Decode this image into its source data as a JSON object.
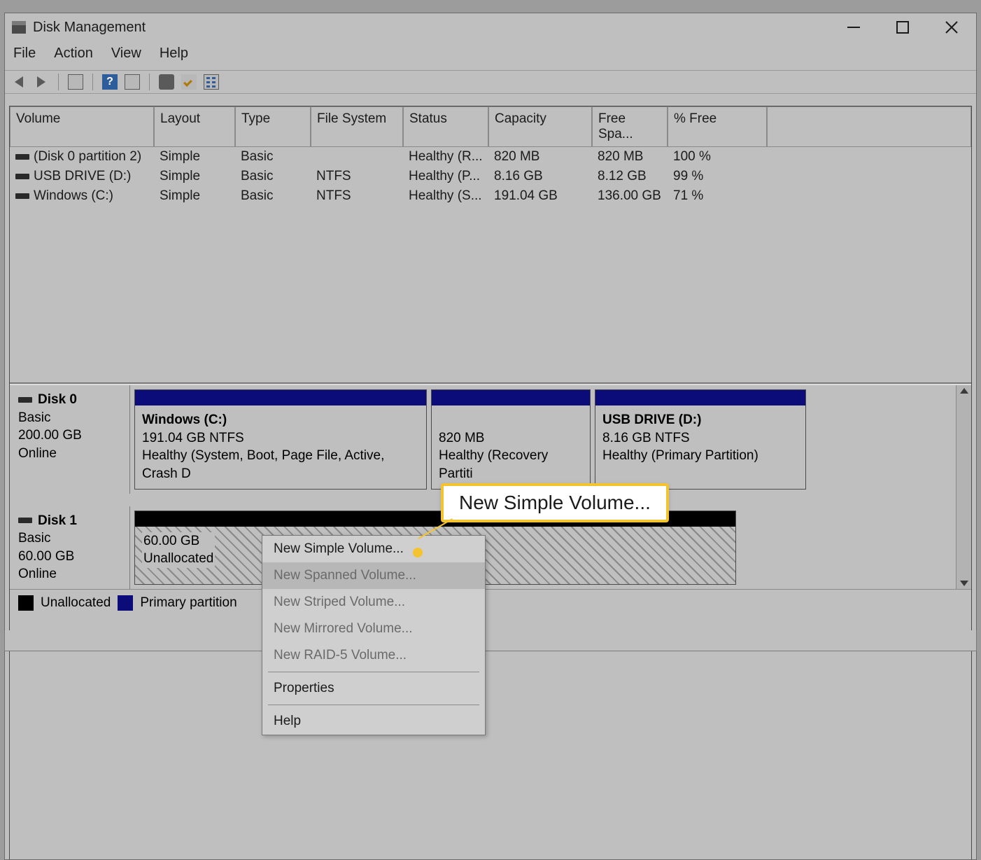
{
  "window": {
    "title": "Disk Management"
  },
  "menu": {
    "file": "File",
    "action": "Action",
    "view": "View",
    "help": "Help"
  },
  "volumes": {
    "columns": [
      "Volume",
      "Layout",
      "Type",
      "File System",
      "Status",
      "Capacity",
      "Free Spa...",
      "% Free"
    ],
    "rows": [
      {
        "volume": "(Disk 0 partition 2)",
        "layout": "Simple",
        "type": "Basic",
        "fs": "",
        "status": "Healthy (R...",
        "capacity": "820 MB",
        "free": "820 MB",
        "pct": "100 %"
      },
      {
        "volume": "USB DRIVE (D:)",
        "layout": "Simple",
        "type": "Basic",
        "fs": "NTFS",
        "status": "Healthy (P...",
        "capacity": "8.16 GB",
        "free": "8.12 GB",
        "pct": "99 %"
      },
      {
        "volume": "Windows (C:)",
        "layout": "Simple",
        "type": "Basic",
        "fs": "NTFS",
        "status": "Healthy (S...",
        "capacity": "191.04 GB",
        "free": "136.00 GB",
        "pct": "71 %"
      }
    ]
  },
  "disks": [
    {
      "name": "Disk 0",
      "type": "Basic",
      "size": "200.00 GB",
      "status": "Online",
      "partitions": [
        {
          "title": "Windows  (C:)",
          "sub": "191.04 GB NTFS",
          "health": "Healthy (System, Boot, Page File, Active, Crash D",
          "kind": "primary"
        },
        {
          "title": "",
          "sub": "820 MB",
          "health": "Healthy (Recovery Partiti",
          "kind": "primary"
        },
        {
          "title": "USB DRIVE  (D:)",
          "sub": "8.16 GB NTFS",
          "health": "Healthy (Primary Partition)",
          "kind": "primary"
        }
      ]
    },
    {
      "name": "Disk 1",
      "type": "Basic",
      "size": "60.00 GB",
      "status": "Online",
      "partitions": [
        {
          "title": "",
          "sub": "60.00 GB",
          "health": "Unallocated",
          "kind": "unallocated"
        }
      ]
    }
  ],
  "legend": {
    "unallocated": "Unallocated",
    "primary": "Primary partition"
  },
  "context_menu": {
    "items": [
      {
        "label": "New Simple Volume...",
        "enabled": true
      },
      {
        "label": "New Spanned Volume...",
        "enabled": false
      },
      {
        "label": "New Striped Volume...",
        "enabled": false
      },
      {
        "label": "New Mirrored Volume...",
        "enabled": false
      },
      {
        "label": "New RAID-5 Volume...",
        "enabled": false
      }
    ],
    "properties": "Properties",
    "help": "Help"
  },
  "callout": {
    "text": "New Simple Volume..."
  }
}
